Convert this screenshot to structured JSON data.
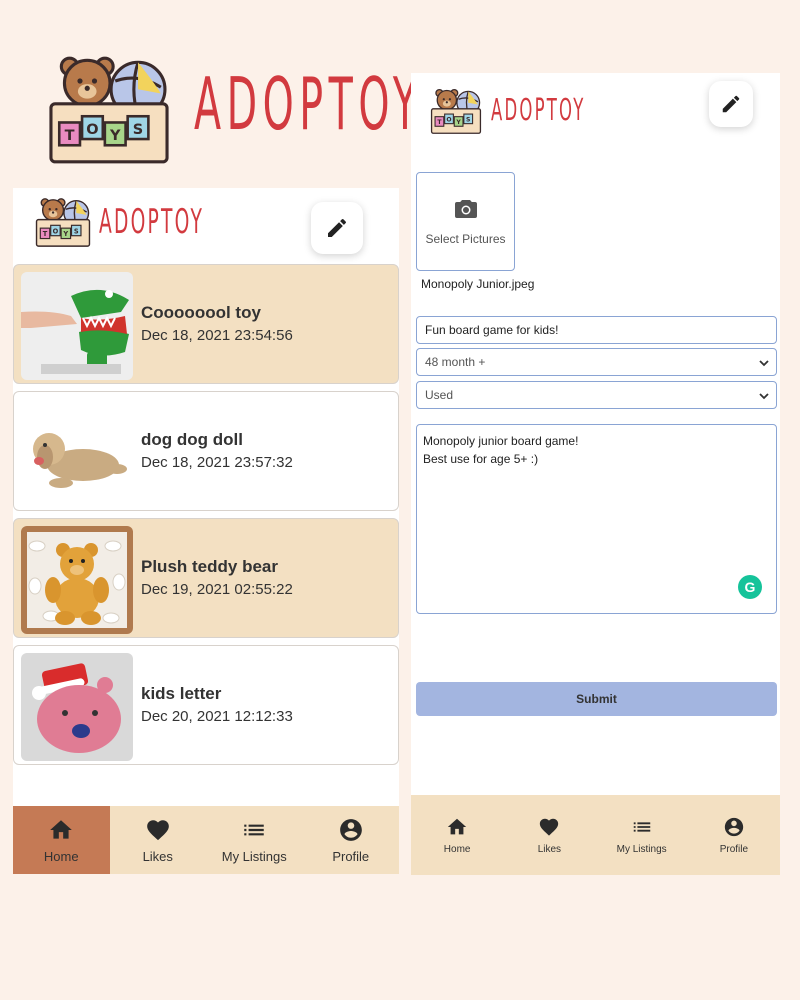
{
  "brand": {
    "name": "ADOPTOY",
    "logo_box_label": "TOYS",
    "color": "#d23a3f"
  },
  "feed": {
    "items": [
      {
        "title": "Coooooool toy",
        "date": "Dec 18, 2021 23:54:56",
        "thumb": "crocodile-dentist-toy"
      },
      {
        "title": "dog dog doll",
        "date": "Dec 18, 2021 23:57:32",
        "thumb": "plush-dog"
      },
      {
        "title": "Plush teddy bear",
        "date": "Dec 19, 2021 02:55:22",
        "thumb": "teddy-bear"
      },
      {
        "title": "kids letter",
        "date": "Dec 20, 2021 12:12:33",
        "thumb": "pink-bear-card"
      }
    ]
  },
  "nav": {
    "items": [
      {
        "label": "Home",
        "icon": "home-icon"
      },
      {
        "label": "Likes",
        "icon": "heart-icon"
      },
      {
        "label": "My Listings",
        "icon": "list-icon"
      },
      {
        "label": "Profile",
        "icon": "account-icon"
      }
    ],
    "active": "Home"
  },
  "form": {
    "select_pictures_label": "Select Pictures",
    "file_name": "Monopoly Junior.jpeg",
    "title_value": "Fun board game for kids!",
    "age_value": "48 month +",
    "condition_value": "Used",
    "description_lines": [
      "Monopoly junior board game!",
      "Best use for age 5+ :)"
    ],
    "grammarly_glyph": "G",
    "submit_label": "Submit"
  },
  "colors": {
    "background": "#fcf1e9",
    "card_tan": "#f3e0c2",
    "nav_active": "#c57a55",
    "submit": "#a3b5e0",
    "field_border": "#8aa4d4"
  }
}
